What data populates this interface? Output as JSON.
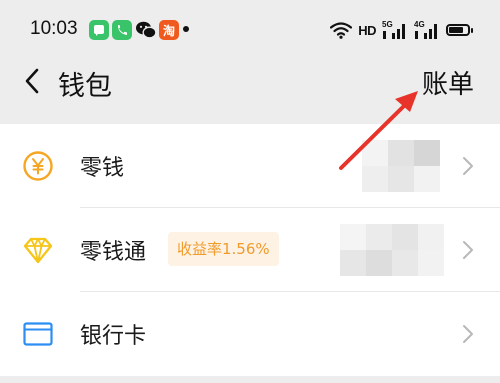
{
  "status_bar": {
    "time": "10:03",
    "network_label": "HD",
    "signal1_label": "5G",
    "signal2_label": "4G",
    "battery_level": 0.8,
    "icons": [
      "messages-app-icon",
      "phone-app-icon",
      "wechat-app-icon",
      "taobao-app-icon",
      "wifi-icon",
      "signal-icon",
      "battery-icon"
    ]
  },
  "nav": {
    "back_icon": "chevron-left-icon",
    "title": "钱包",
    "bill_label": "账单"
  },
  "items": [
    {
      "label": "零钱",
      "icon": "yuan-coin-icon",
      "value_blurred": true
    },
    {
      "label": "零钱通",
      "icon": "diamond-icon",
      "badge": "收益率1.56%",
      "value_blurred": true
    },
    {
      "label": "银行卡",
      "icon": "bank-card-icon"
    }
  ],
  "colors": {
    "background": "#ededed",
    "accent_orange": "#f19b2b",
    "badge_bg": "#fdf2e4",
    "card_blue": "#2c8ef2",
    "annotation_red": "#e8332a"
  }
}
